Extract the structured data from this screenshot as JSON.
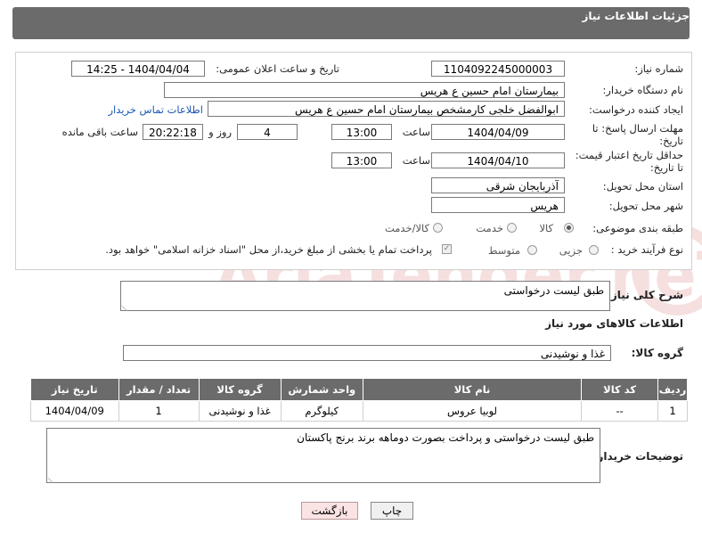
{
  "header": {
    "title": "جزئیات اطلاعات نیاز"
  },
  "form": {
    "need_number_label": "شماره نیاز:",
    "need_number": "1104092245000003",
    "announce_label": "تاریخ و ساعت اعلان عمومی:",
    "announce_value": "1404/04/04 - 14:25",
    "buyer_org_label": "نام دستگاه خریدار:",
    "buyer_org": "بیمارستان امام حسین ع  هریس",
    "requester_label": "ایجاد کننده درخواست:",
    "requester": "ابوالفضل خلجی کارمشخص بیمارستان امام حسین ع  هریس",
    "contact_link": "اطلاعات تماس خریدار",
    "deadline_label_1": "مهلت ارسال پاسخ: تا",
    "deadline_label_2": "تاریخ:",
    "deadline_date": "1404/04/09",
    "time_label": "ساعت",
    "deadline_time": "13:00",
    "days_value": "4",
    "days_label": "روز و",
    "remaining_time": "20:22:18",
    "remaining_label": "ساعت باقی مانده",
    "price_validity_label_1": "حداقل تاریخ اعتبار قیمت:",
    "price_validity_label_2": "تا تاریخ:",
    "price_validity_date": "1404/04/10",
    "price_validity_time": "13:00",
    "province_label": "استان محل تحویل:",
    "province": "آذربایجان شرقی",
    "city_label": "شهر محل تحویل:",
    "city": "هریس",
    "category_label": "طبقه بندی موضوعی:",
    "category_options": [
      "کالا",
      "خدمت",
      "کالا/خدمت"
    ],
    "category_selected": "کالا",
    "process_label": "نوع فرآیند خرید :",
    "process_options": [
      "جزیی",
      "متوسط"
    ],
    "payment_note": "پرداخت تمام یا بخشی از مبلغ خرید،از محل \"اسناد خزانه اسلامی\" خواهد بود."
  },
  "summary": {
    "label": "شرح کلی نیاز:",
    "value": "طبق لیست درخواستی"
  },
  "goods_section": {
    "title": "اطلاعات کالاهای مورد نیاز",
    "group_label": "گروه کالا:",
    "group_value": "غذا و نوشیدنی"
  },
  "table": {
    "headers": [
      "ردیف",
      "کد کالا",
      "نام کالا",
      "واحد شمارش",
      "گروه کالا",
      "تعداد / مقدار",
      "تاریخ نیاز"
    ],
    "rows": [
      [
        "1",
        "--",
        "لوبیا عروس",
        "کیلوگرم",
        "غذا و نوشیدنی",
        "1",
        "1404/04/09"
      ]
    ]
  },
  "buyer_notes": {
    "label": "توضیحات خریدار:",
    "value": "طبق لیست درخواستی و پرداخت بصورت دوماهه برند برنج پاکستان"
  },
  "buttons": {
    "print": "چاپ",
    "back": "بازگشت"
  },
  "watermark": "AriaTender.neT"
}
